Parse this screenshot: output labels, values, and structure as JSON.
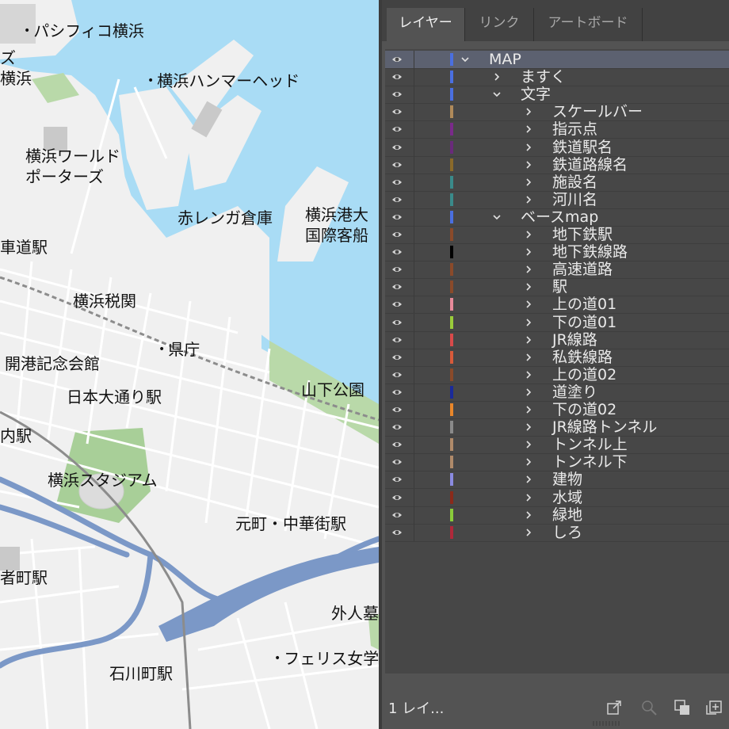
{
  "map": {
    "labels": [
      {
        "text": "パシフィコ横浜",
        "dot": true
      },
      {
        "text": "ズ",
        "dot": false
      },
      {
        "text": "横浜",
        "dot": false
      },
      {
        "text": "横浜ハンマーヘッド",
        "dot": true
      },
      {
        "text": "横浜ワールド",
        "dot": false
      },
      {
        "text": "ポーターズ",
        "dot": false
      },
      {
        "text": "赤レンガ倉庫",
        "dot": false
      },
      {
        "text": "横浜港大",
        "dot": false
      },
      {
        "text": "国際客船",
        "dot": false
      },
      {
        "text": "車道駅",
        "dot": false
      },
      {
        "text": "横浜税関",
        "dot": false
      },
      {
        "text": "県庁",
        "dot": false
      },
      {
        "text": "開港記念会館",
        "dot": false
      },
      {
        "text": "日本大通り駅",
        "dot": false
      },
      {
        "text": "山下公園",
        "dot": false
      },
      {
        "text": "内駅",
        "dot": false
      },
      {
        "text": "横浜スタジアム",
        "dot": false
      },
      {
        "text": "元町・中華街駅",
        "dot": false
      },
      {
        "text": "者町駅",
        "dot": false
      },
      {
        "text": "外人墓",
        "dot": false
      },
      {
        "text": "フェリス女学",
        "dot": true
      },
      {
        "text": "石川町駅",
        "dot": false
      }
    ]
  },
  "panel": {
    "tabs": [
      "レイヤー",
      "リンク",
      "アートボード"
    ],
    "active_tab": 0,
    "layers": [
      {
        "name": "MAP",
        "color": "#4a6fe0",
        "expanded": true,
        "selected": true
      },
      {
        "name": "ますく",
        "color": "#4a6fe0",
        "expanded": false
      },
      {
        "name": "文字",
        "color": "#4a6fe0",
        "expanded": true
      },
      {
        "name": "スケールバー",
        "color": "#b08a5a",
        "expanded": false
      },
      {
        "name": "指示点",
        "color": "#7a2a8a",
        "expanded": false
      },
      {
        "name": "鉄道駅名",
        "color": "#6a2a7a",
        "expanded": false
      },
      {
        "name": "鉄道路線名",
        "color": "#8a6a2a",
        "expanded": false
      },
      {
        "name": "施設名",
        "color": "#3a8a8a",
        "expanded": false
      },
      {
        "name": "河川名",
        "color": "#3a8a8a",
        "expanded": false
      },
      {
        "name": "ベースmap",
        "color": "#4a6fe0",
        "expanded": true
      },
      {
        "name": "地下鉄駅",
        "color": "#8a4a2a",
        "expanded": false
      },
      {
        "name": "地下鉄線路",
        "color": "#000000",
        "expanded": false
      },
      {
        "name": "高速道路",
        "color": "#8a4a2a",
        "expanded": false
      },
      {
        "name": "駅",
        "color": "#8a4a2a",
        "expanded": false
      },
      {
        "name": "上の道01",
        "color": "#e88a9a",
        "expanded": false
      },
      {
        "name": "下の道01",
        "color": "#9acc3a",
        "expanded": false
      },
      {
        "name": "JR線路",
        "color": "#d84a4a",
        "expanded": false
      },
      {
        "name": "私鉄線路",
        "color": "#d85a3a",
        "expanded": false
      },
      {
        "name": "上の道02",
        "color": "#8a4a2a",
        "expanded": false
      },
      {
        "name": "道塗り",
        "color": "#1a2a9a",
        "expanded": false
      },
      {
        "name": "下の道02",
        "color": "#e8862a",
        "expanded": false
      },
      {
        "name": "JR線路トンネル",
        "color": "#8a8a8a",
        "expanded": false
      },
      {
        "name": "トンネル上",
        "color": "#b08a6a",
        "expanded": false
      },
      {
        "name": "トンネル下",
        "color": "#b08a6a",
        "expanded": false
      },
      {
        "name": "建物",
        "color": "#8a8ae0",
        "expanded": false
      },
      {
        "name": "水域",
        "color": "#8a2a1a",
        "expanded": false
      },
      {
        "name": "緑地",
        "color": "#8acc3a",
        "expanded": false
      },
      {
        "name": "しろ",
        "color": "#b0283a",
        "expanded": false
      }
    ],
    "layer_depths": [
      0,
      1,
      1,
      2,
      2,
      2,
      2,
      2,
      2,
      1,
      2,
      2,
      2,
      2,
      2,
      2,
      2,
      2,
      2,
      2,
      2,
      2,
      2,
      2,
      2,
      2,
      2,
      2
    ],
    "footer": {
      "count_label": "1 レイ...",
      "icons": [
        "export-icon",
        "locate-icon",
        "clipping-mask-icon",
        "new-sublayer-icon"
      ]
    }
  }
}
